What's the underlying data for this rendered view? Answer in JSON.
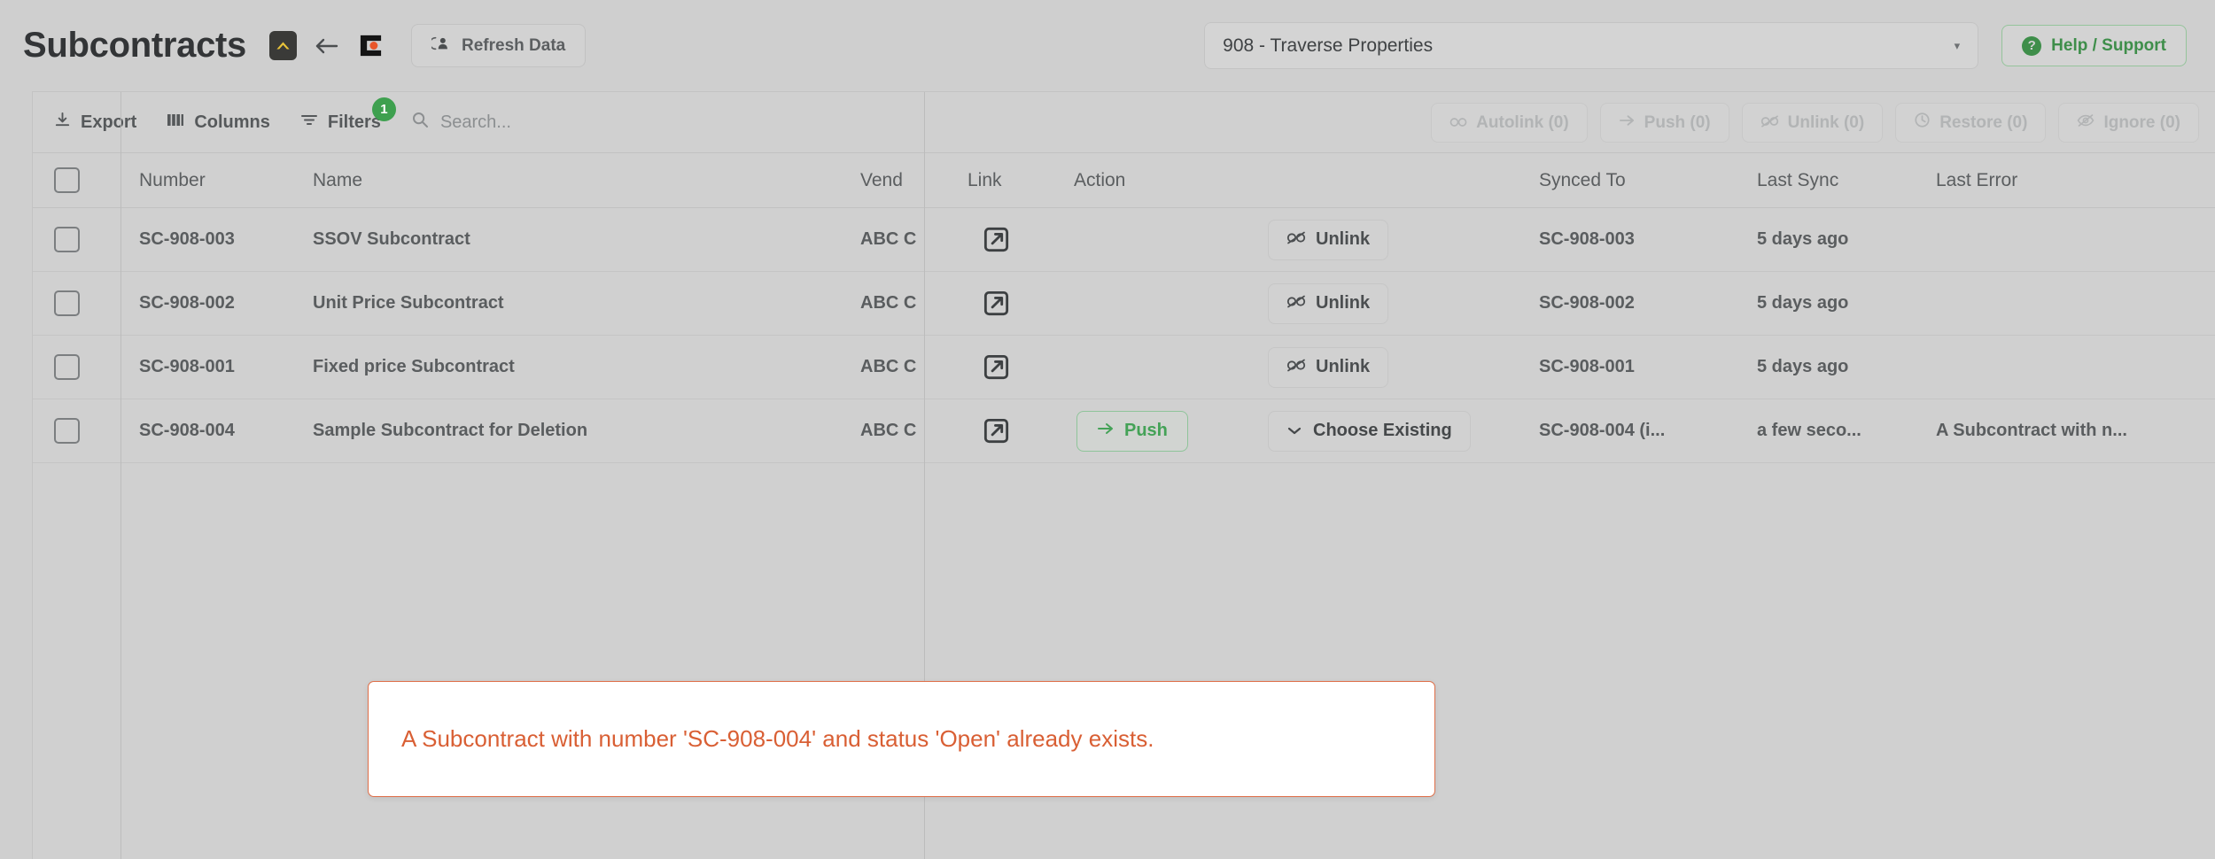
{
  "header": {
    "title": "Subcontracts",
    "icons": {
      "autodesk": "autodesk-logo-icon",
      "back_arrow": "arrow-left-icon",
      "procore": "procore-logo-icon"
    },
    "refresh_label": "Refresh Data",
    "project_value": "908 - Traverse Properties",
    "help_label": "Help / Support",
    "help_icon_glyph": "?"
  },
  "toolbar": {
    "export_label": "Export",
    "columns_label": "Columns",
    "filters_label": "Filters",
    "filters_badge": "1",
    "search_placeholder": "Search...",
    "actions": [
      {
        "label": "Autolink (0)",
        "icon": "link-chain-icon",
        "disabled": true
      },
      {
        "label": "Push (0)",
        "icon": "arrow-right-icon",
        "disabled": true
      },
      {
        "label": "Unlink (0)",
        "icon": "broken-link-icon",
        "disabled": true
      },
      {
        "label": "Restore (0)",
        "icon": "clock-restore-icon",
        "disabled": true
      },
      {
        "label": "Ignore (0)",
        "icon": "eye-off-icon",
        "disabled": true
      }
    ]
  },
  "table": {
    "columns": {
      "number": "Number",
      "name": "Name",
      "vendor": "Vend",
      "link": "Link",
      "action": "Action",
      "blank": "",
      "synced_to": "Synced To",
      "last_sync": "Last Sync",
      "last_error": "Last Error"
    },
    "rows": [
      {
        "number": "SC-908-003",
        "name": "SSOV Subcontract",
        "vendor": "ABC C",
        "link_icon": "external-link-icon",
        "action": "",
        "secondary_action": "Unlink",
        "secondary_action_type": "unlink",
        "synced_to": "SC-908-003",
        "last_sync": "5 days ago",
        "last_sync_style": "green",
        "last_error": ""
      },
      {
        "number": "SC-908-002",
        "name": "Unit Price Subcontract",
        "vendor": "ABC C",
        "link_icon": "external-link-icon",
        "action": "",
        "secondary_action": "Unlink",
        "secondary_action_type": "unlink",
        "synced_to": "SC-908-002",
        "last_sync": "5 days ago",
        "last_sync_style": "green",
        "last_error": ""
      },
      {
        "number": "SC-908-001",
        "name": "Fixed price Subcontract",
        "vendor": "ABC C",
        "link_icon": "external-link-icon",
        "action": "",
        "secondary_action": "Unlink",
        "secondary_action_type": "unlink",
        "synced_to": "SC-908-001",
        "last_sync": "5 days ago",
        "last_sync_style": "green",
        "last_error": ""
      },
      {
        "number": "SC-908-004",
        "name": "Sample Subcontract for Deletion",
        "vendor": "ABC C",
        "link_icon": "external-link-icon",
        "action": "Push",
        "secondary_action": "Choose Existing",
        "secondary_action_type": "choose",
        "synced_to": "SC-908-004 (i...",
        "last_sync": "a few seco...",
        "last_sync_style": "dark",
        "last_error": "A Subcontract with n..."
      }
    ]
  },
  "message": {
    "text": "A Subcontract with number 'SC-908-004' and status 'Open' already exists."
  },
  "colors": {
    "accent_green": "#3e9a4f",
    "error_red": "#d95f34",
    "badge_green": "#3ea04f",
    "page_bg": "#cfcfcf",
    "grid_bg": "#d0d0d0"
  }
}
